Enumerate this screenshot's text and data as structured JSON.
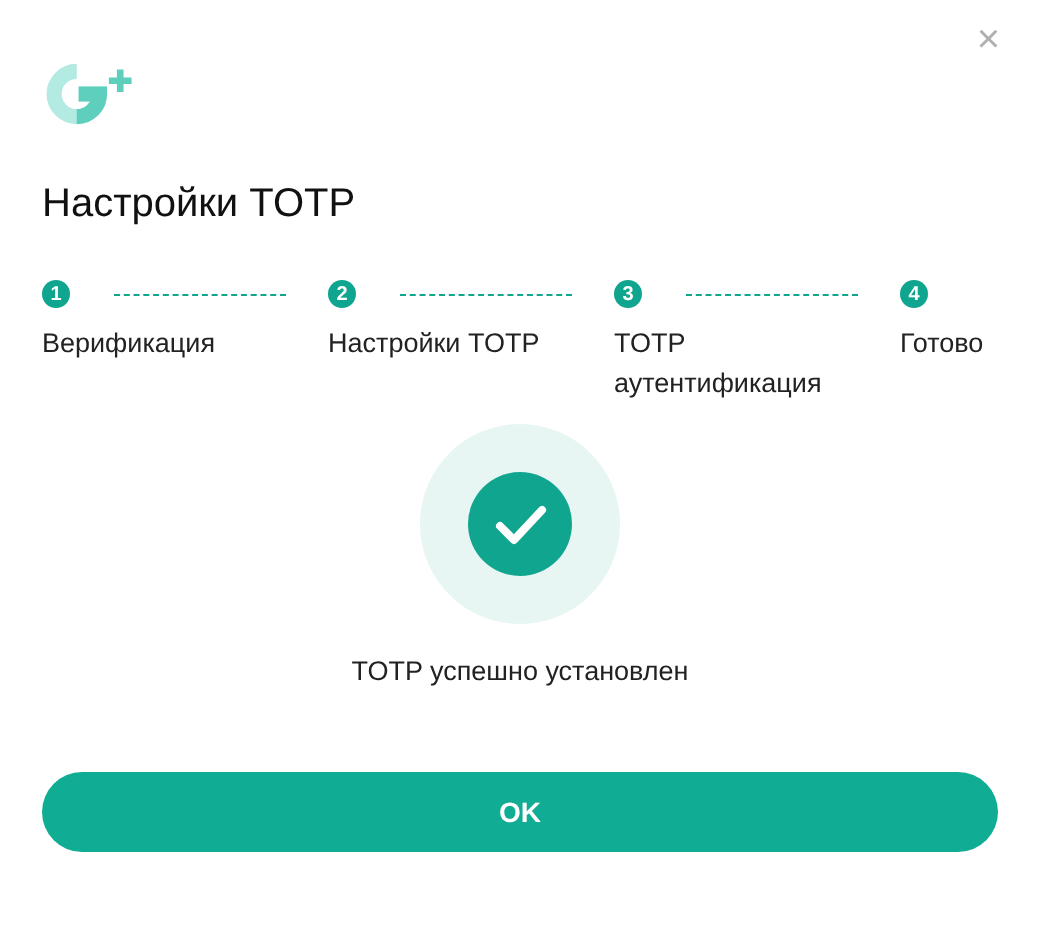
{
  "dialog": {
    "title": "Настройки TOTP",
    "close": "×"
  },
  "steps": [
    {
      "number": "1",
      "label": "Верификация",
      "done": true
    },
    {
      "number": "2",
      "label": "Настройки TOTP",
      "done": true
    },
    {
      "number": "3",
      "label": "TOTP аутентификация",
      "done": true
    },
    {
      "number": "4",
      "label": "Готово",
      "done": true
    }
  ],
  "result": {
    "message": "TOTP успешно установлен"
  },
  "buttons": [
    "OK"
  ]
}
